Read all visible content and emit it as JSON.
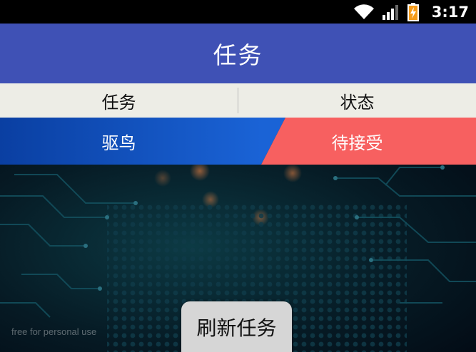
{
  "status_bar": {
    "time": "3:17",
    "icons": [
      "wifi-icon",
      "signal-icon",
      "battery-charging-icon"
    ]
  },
  "app_bar": {
    "title": "任务"
  },
  "table": {
    "headers": [
      "任务",
      "状态"
    ],
    "rows": [
      {
        "task": "驱鸟",
        "status": "待接受"
      }
    ]
  },
  "watermark": "free for personal use",
  "refresh_button": {
    "label": "刷新任务"
  },
  "colors": {
    "app_bar": "#3f51b5",
    "header_bg": "#edede6",
    "task_cell": "#1a63d6",
    "status_cell": "#f76060",
    "button_bg": "#d6d6d6"
  }
}
